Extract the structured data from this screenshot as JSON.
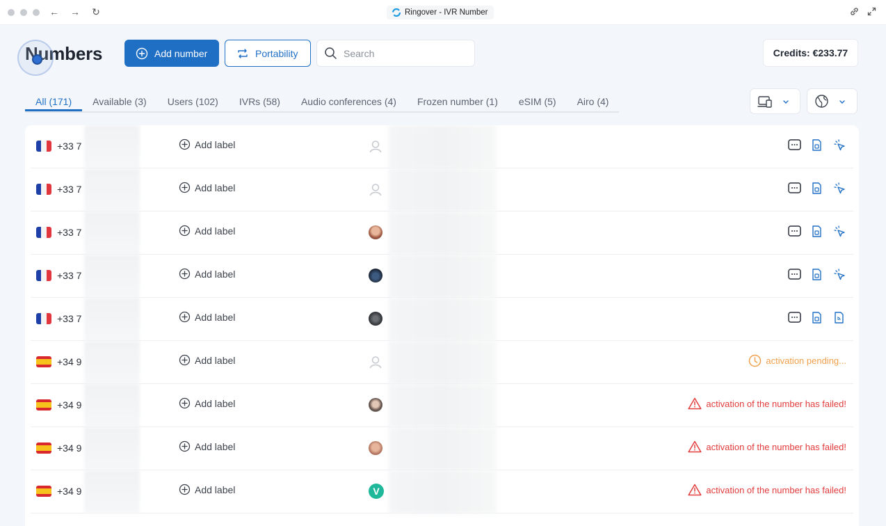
{
  "window": {
    "title": "Ringover - IVR Number"
  },
  "header": {
    "title": "Numbers",
    "add_number_label": "Add number",
    "portability_label": "Portability",
    "search_placeholder": "Search",
    "credits": "Credits: €233.77"
  },
  "tabs": [
    {
      "label": "All (171)",
      "active": true
    },
    {
      "label": "Available (3)",
      "active": false
    },
    {
      "label": "Users (102)",
      "active": false
    },
    {
      "label": "IVRs (58)",
      "active": false
    },
    {
      "label": "Audio conferences (4)",
      "active": false
    },
    {
      "label": "Frozen number (1)",
      "active": false
    },
    {
      "label": "eSIM (5)",
      "active": false
    },
    {
      "label": "Airo (4)",
      "active": false
    }
  ],
  "add_label_text": "Add label",
  "rows": [
    {
      "country": "fr",
      "number": "+33 7",
      "avatar": "placeholder",
      "third_icon": "cursor"
    },
    {
      "country": "fr",
      "number": "+33 7",
      "avatar": "placeholder",
      "third_icon": "cursor"
    },
    {
      "country": "fr",
      "number": "+33 7",
      "avatar": "photo-1",
      "third_icon": "cursor"
    },
    {
      "country": "fr",
      "number": "+33 7",
      "avatar": "photo-2",
      "third_icon": "cursor"
    },
    {
      "country": "fr",
      "number": "+33 7",
      "avatar": "photo-3",
      "third_icon": "rss"
    },
    {
      "country": "es",
      "number": "+34 9",
      "avatar": "placeholder",
      "status": "activation pending...",
      "status_type": "pending"
    },
    {
      "country": "es",
      "number": "+34 9",
      "avatar": "photo-4",
      "status": "activation of the number has failed!",
      "status_type": "failed"
    },
    {
      "country": "es",
      "number": "+34 9",
      "avatar": "photo-5",
      "status": "activation of the number has failed!",
      "status_type": "failed"
    },
    {
      "country": "es",
      "number": "+34 9",
      "avatar": "letter",
      "avatar_letter": "V",
      "status": "activation of the number has failed!",
      "status_type": "failed"
    }
  ],
  "colors": {
    "primary": "#1f6fc5",
    "pending": "#f0a04b",
    "failed": "#e23b3b",
    "background": "#f3f6fb"
  }
}
